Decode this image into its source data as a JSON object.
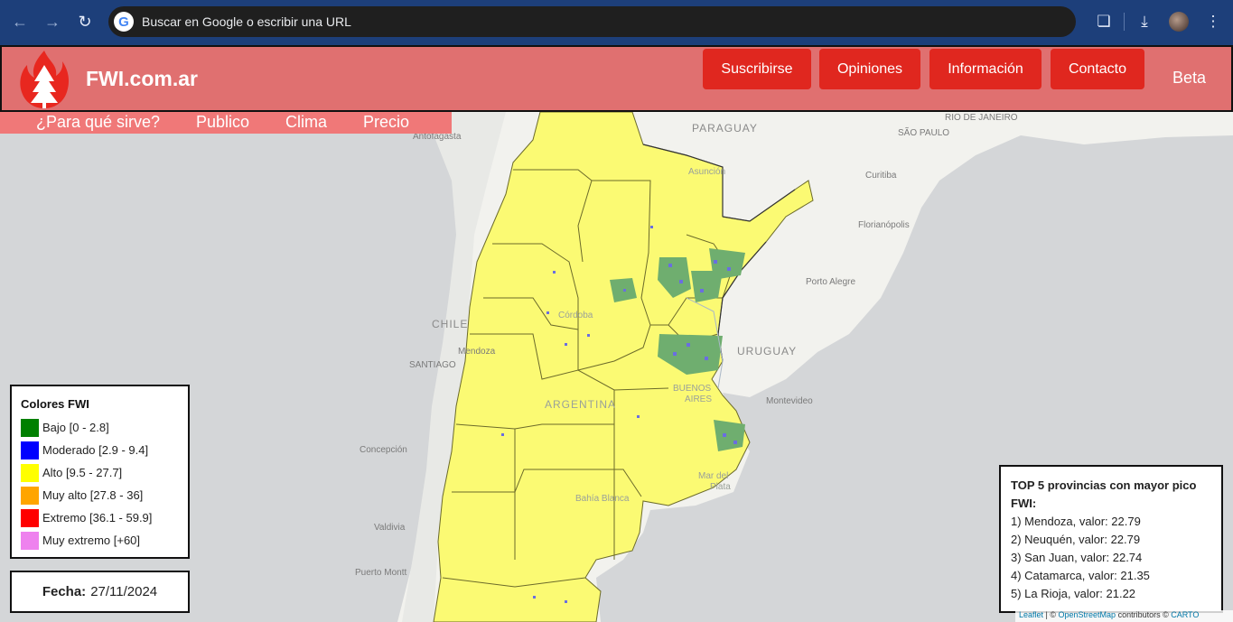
{
  "browser": {
    "omnibox_text": "Buscar en Google o escribir una URL",
    "icons": [
      "back-icon",
      "forward-icon",
      "reload-icon",
      "google-icon",
      "extensions-icon",
      "download-icon",
      "profile-avatar",
      "menu-icon"
    ]
  },
  "header": {
    "title": "FWI.com.ar",
    "buttons": [
      "Suscribirse",
      "Opiniones",
      "Información",
      "Contacto"
    ],
    "beta": "Beta",
    "subnav": [
      "¿Para qué sirve?",
      "Publico",
      "Clima",
      "Precio"
    ]
  },
  "map_labels": {
    "paraguay": "PARAGUAY",
    "rio": "RIO DE JANEIRO",
    "saopaulo": "SÃO PAULO",
    "antofagasta": "Antofagasta",
    "asuncion": "Asunción",
    "curitiba": "Curitiba",
    "florianopolis": "Florianópolis",
    "portoalegre": "Porto Alegre",
    "chile": "CHILE",
    "cordoba": "Córdoba",
    "mendoza": "Mendoza",
    "santiago": "SANTIAGO",
    "uruguay": "URUGUAY",
    "argentina": "ARGENTINA",
    "buenosaires1": "BUENOS",
    "buenosaires2": "AIRES",
    "montevideo": "Montevideo",
    "concepcion": "Concepción",
    "mardelplata1": "Mar del",
    "mardelplata2": "Plata",
    "bahiablanca": "Bahía Blanca",
    "valdivia": "Valdivia",
    "puertomontt": "Puerto Montt"
  },
  "legend": {
    "title": "Colores FWI",
    "items": [
      {
        "label": "Bajo [0 - 2.8]",
        "color": "#008000"
      },
      {
        "label": "Moderado [2.9 - 9.4]",
        "color": "#0000ff"
      },
      {
        "label": "Alto [9.5 - 27.7]",
        "color": "#ffff00"
      },
      {
        "label": "Muy alto [27.8 - 36]",
        "color": "#ffa500"
      },
      {
        "label": "Extremo [36.1 - 59.9]",
        "color": "#ff0000"
      },
      {
        "label": "Muy extremo [+60]",
        "color": "#ee82ee"
      }
    ]
  },
  "fecha": {
    "label": "Fecha:",
    "value": "27/11/2024"
  },
  "top5": {
    "title": "TOP 5 provincias con mayor pico FWI:",
    "items": [
      "1) Mendoza, valor: 22.79",
      "2) Neuquén, valor: 22.79",
      "3) San Juan, valor: 22.74",
      "4) Catamarca, valor: 21.35",
      "5) La Rioja, valor: 21.22"
    ]
  },
  "attribution": {
    "leaflet": "Leaflet",
    "sep": " | © ",
    "osm": "OpenStreetMap",
    "mid": " contributors © ",
    "carto": "CARTO"
  },
  "colors": {
    "header_bg": "#e07070",
    "button_bg": "#e0271f",
    "map_fill": "#fbfa73"
  }
}
